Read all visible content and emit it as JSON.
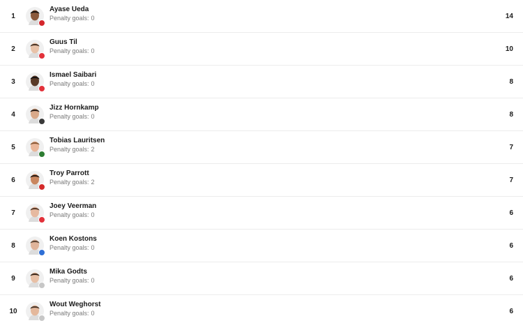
{
  "penalty_label": "Penalty goals:",
  "players": [
    {
      "rank": "1",
      "name": "Ayase Ueda",
      "penalty_goals": "0",
      "goals": "14",
      "skin": "#8c5a3c",
      "hair": "#1b1410",
      "club_color": "#d4262c"
    },
    {
      "rank": "2",
      "name": "Guus Til",
      "penalty_goals": "0",
      "goals": "10",
      "skin": "#e8c2a8",
      "hair": "#4a3424",
      "club_color": "#e2313a"
    },
    {
      "rank": "3",
      "name": "Ismael Saibari",
      "penalty_goals": "0",
      "goals": "8",
      "skin": "#5a3a28",
      "hair": "#151010",
      "club_color": "#e2313a"
    },
    {
      "rank": "4",
      "name": "Jizz Hornkamp",
      "penalty_goals": "0",
      "goals": "8",
      "skin": "#d9a98a",
      "hair": "#251a14",
      "club_color": "#3a3a3a"
    },
    {
      "rank": "5",
      "name": "Tobias Lauritsen",
      "penalty_goals": "2",
      "goals": "7",
      "skin": "#eab79a",
      "hair": "#8a5a36",
      "club_color": "#2e7d32"
    },
    {
      "rank": "6",
      "name": "Troy Parrott",
      "penalty_goals": "2",
      "goals": "7",
      "skin": "#c9865f",
      "hair": "#2a1a12",
      "club_color": "#d42a2a"
    },
    {
      "rank": "7",
      "name": "Joey Veerman",
      "penalty_goals": "0",
      "goals": "6",
      "skin": "#e6b9a0",
      "hair": "#5a3a28",
      "club_color": "#e2313a"
    },
    {
      "rank": "8",
      "name": "Koen Kostons",
      "penalty_goals": "0",
      "goals": "6",
      "skin": "#e0b49a",
      "hair": "#5c4432",
      "club_color": "#2f6fd6"
    },
    {
      "rank": "9",
      "name": "Mika Godts",
      "penalty_goals": "0",
      "goals": "6",
      "skin": "#e8c0a6",
      "hair": "#3a2618",
      "club_color": "#c7c7c7"
    },
    {
      "rank": "10",
      "name": "Wout Weghorst",
      "penalty_goals": "0",
      "goals": "6",
      "skin": "#e4b89c",
      "hair": "#4a3628",
      "club_color": "#c7c7c7"
    }
  ]
}
